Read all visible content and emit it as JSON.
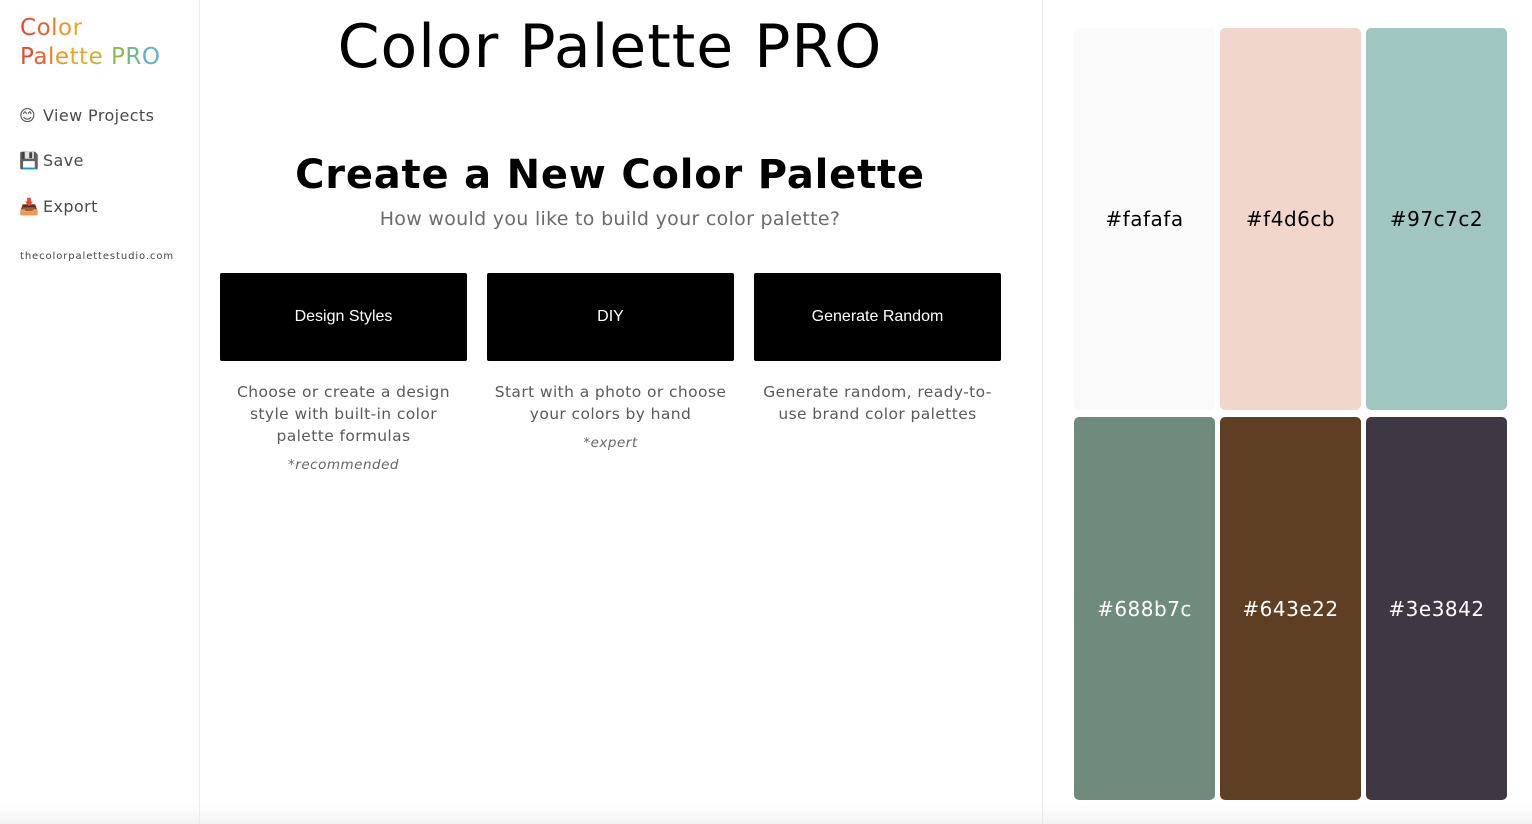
{
  "logo": {
    "line1": "Color",
    "line2": "Palette PRO",
    "line1_colors": [
      "#e84a2e",
      "#e8622a",
      "#ea7d26",
      "#eb9725",
      "#eca824"
    ],
    "line2_colors": [
      "#e84a2e",
      "#e8622a",
      "#ea7d26",
      "#eb9725",
      "#eca824",
      "#e2ae2c",
      "#c6b237",
      " ",
      "#8bbd4d",
      "#6cb98a",
      "#5fb1c4"
    ]
  },
  "sidebar": {
    "items": [
      {
        "icon": "😊",
        "icon_name": "smiley-icon",
        "label": "View Projects"
      },
      {
        "icon": "💾",
        "icon_name": "floppy-disk-icon",
        "label": "Save"
      },
      {
        "icon": "📥",
        "icon_name": "inbox-tray-icon",
        "label": "Export"
      }
    ],
    "site": "thecolorpalettestudio.com"
  },
  "main": {
    "app_title": "Color Palette PRO",
    "section_title": "Create a New Color Palette",
    "section_subtitle": "How would you like to build your color palette?",
    "options": [
      {
        "button": "Design Styles",
        "description": "Choose or create a design style with built-in color palette formulas",
        "note": "*recommended"
      },
      {
        "button": "DIY",
        "description": "Start with a photo or choose your colors by hand",
        "note": "*expert"
      },
      {
        "button": "Generate Random",
        "description": "Generate random, ready-to-use brand color palettes",
        "note": ""
      }
    ]
  },
  "palette": {
    "swatches": [
      {
        "hex": "#fafafa",
        "color": "#fafafa",
        "text_color": "#000000"
      },
      {
        "hex": "#f4d6cb",
        "color": "#f0d6cb",
        "text_color": "#000000"
      },
      {
        "hex": "#97c7c2",
        "color": "#a0c6c2",
        "text_color": "#000000"
      },
      {
        "hex": "#688b7c",
        "color": "#708a7c",
        "text_color": "#ffffff"
      },
      {
        "hex": "#643e22",
        "color": "#5e3f24",
        "text_color": "#ffffff"
      },
      {
        "hex": "#3e3842",
        "color": "#3d3843",
        "text_color": "#ffffff"
      }
    ]
  }
}
